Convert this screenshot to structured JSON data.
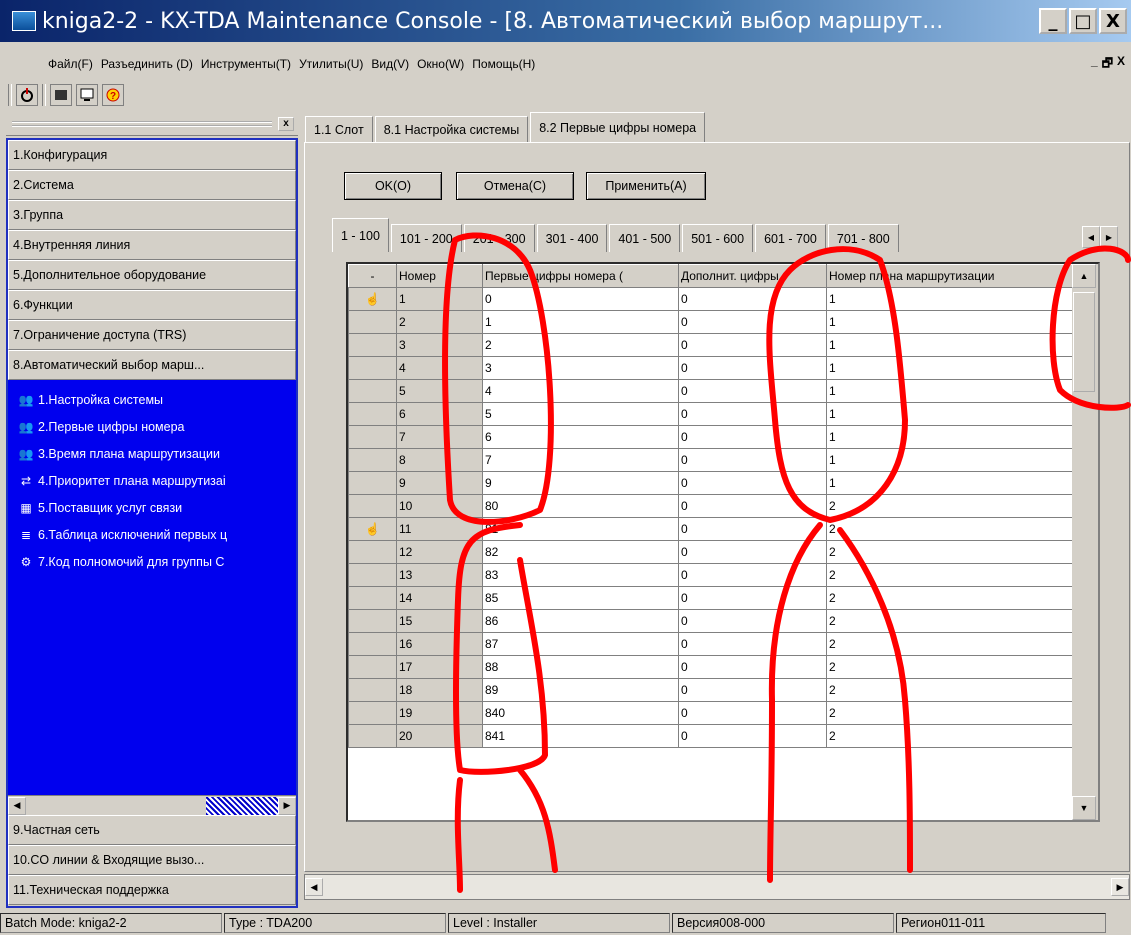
{
  "window": {
    "title": "kniga2-2 - KX-TDA Maintenance Console - [8. Автоматический выбор маршрут...",
    "minimize": "_",
    "maximize": "□",
    "close": "X"
  },
  "menu": {
    "items": [
      "Файл(F)",
      "Разъединить (D)",
      "Инструменты(T)",
      "Утилиты(U)",
      "Вид(V)",
      "Окно(W)",
      "Помощь(H)"
    ],
    "mdi_buttons": [
      "_",
      "🗗",
      "X"
    ]
  },
  "toolbar": {
    "icons": [
      "connect-icon",
      "device-icon",
      "monitor-icon",
      "help-icon"
    ]
  },
  "left_panel": {
    "close": "x",
    "categories_top": [
      "1.Конфигурация",
      "2.Система",
      "3.Группа",
      "4.Внутренняя линия",
      "5.Дополнительное оборудование",
      "6.Функции",
      "7.Ограничение доступа (TRS)",
      "8.Автоматический выбор марш..."
    ],
    "sub_items": [
      {
        "label": "1.Настройка системы",
        "icon": "people-icon"
      },
      {
        "label": "2.Первые цифры номера",
        "icon": "people-icon"
      },
      {
        "label": "3.Время плана маршрутизации",
        "icon": "people-icon"
      },
      {
        "label": "4.Приоритет плана маршрутизаі",
        "icon": "route-icon"
      },
      {
        "label": "5.Поставщик услуг связи",
        "icon": "table-icon"
      },
      {
        "label": "6.Таблица исключений первых ц",
        "icon": "list-icon"
      },
      {
        "label": "7.Код полномочий для группы С",
        "icon": "group-icon"
      }
    ],
    "categories_bottom": [
      "9.Частная сеть",
      "10.CO линии & Входящие вызо...",
      "11.Техническая поддержка"
    ]
  },
  "tabs": [
    {
      "label": "1.1 Слот",
      "active": false
    },
    {
      "label": "8.1 Настройка системы",
      "active": false
    },
    {
      "label": "8.2 Первые цифры номера",
      "active": true
    }
  ],
  "buttons": {
    "ok": "OK(O)",
    "cancel": "Отмена(C)",
    "apply": "Применить(A)"
  },
  "subtabs": [
    "1 - 100",
    "101 - 200",
    "201 - 300",
    "301 - 400",
    "401 - 500",
    "501 - 600",
    "601 - 700",
    "701 - 800"
  ],
  "grid": {
    "headers": [
      "-",
      "Номер",
      "Первые цифры номера (",
      "Дополнит. цифры",
      "Номер плана маршрутизации"
    ],
    "rows": [
      {
        "n": "1",
        "digits": "0",
        "extra": "0",
        "plan": "1",
        "marker": true
      },
      {
        "n": "2",
        "digits": "1",
        "extra": "0",
        "plan": "1"
      },
      {
        "n": "3",
        "digits": "2",
        "extra": "0",
        "plan": "1"
      },
      {
        "n": "4",
        "digits": "3",
        "extra": "0",
        "plan": "1"
      },
      {
        "n": "5",
        "digits": "4",
        "extra": "0",
        "plan": "1"
      },
      {
        "n": "6",
        "digits": "5",
        "extra": "0",
        "plan": "1"
      },
      {
        "n": "7",
        "digits": "6",
        "extra": "0",
        "plan": "1"
      },
      {
        "n": "8",
        "digits": "7",
        "extra": "0",
        "plan": "1"
      },
      {
        "n": "9",
        "digits": "9",
        "extra": "0",
        "plan": "1"
      },
      {
        "n": "10",
        "digits": "80",
        "extra": "0",
        "plan": "2"
      },
      {
        "n": "11",
        "digits": "81",
        "extra": "0",
        "plan": "2",
        "marker": true
      },
      {
        "n": "12",
        "digits": "82",
        "extra": "0",
        "plan": "2"
      },
      {
        "n": "13",
        "digits": "83",
        "extra": "0",
        "plan": "2"
      },
      {
        "n": "14",
        "digits": "85",
        "extra": "0",
        "plan": "2"
      },
      {
        "n": "15",
        "digits": "86",
        "extra": "0",
        "plan": "2"
      },
      {
        "n": "16",
        "digits": "87",
        "extra": "0",
        "plan": "2"
      },
      {
        "n": "17",
        "digits": "88",
        "extra": "0",
        "plan": "2"
      },
      {
        "n": "18",
        "digits": "89",
        "extra": "0",
        "plan": "2"
      },
      {
        "n": "19",
        "digits": "840",
        "extra": "0",
        "plan": "2"
      },
      {
        "n": "20",
        "digits": "841",
        "extra": "0",
        "plan": "2"
      }
    ]
  },
  "status": {
    "batch": "Batch Mode: kniga2-2",
    "type": "Type : TDA200",
    "level": "Level : Installer",
    "version": "Версия008-000",
    "region": "Регион011-011"
  },
  "colors": {
    "annotation_red": "#ff0000",
    "selection_blue": "#0000ee",
    "title_blue": "#0a246a"
  }
}
